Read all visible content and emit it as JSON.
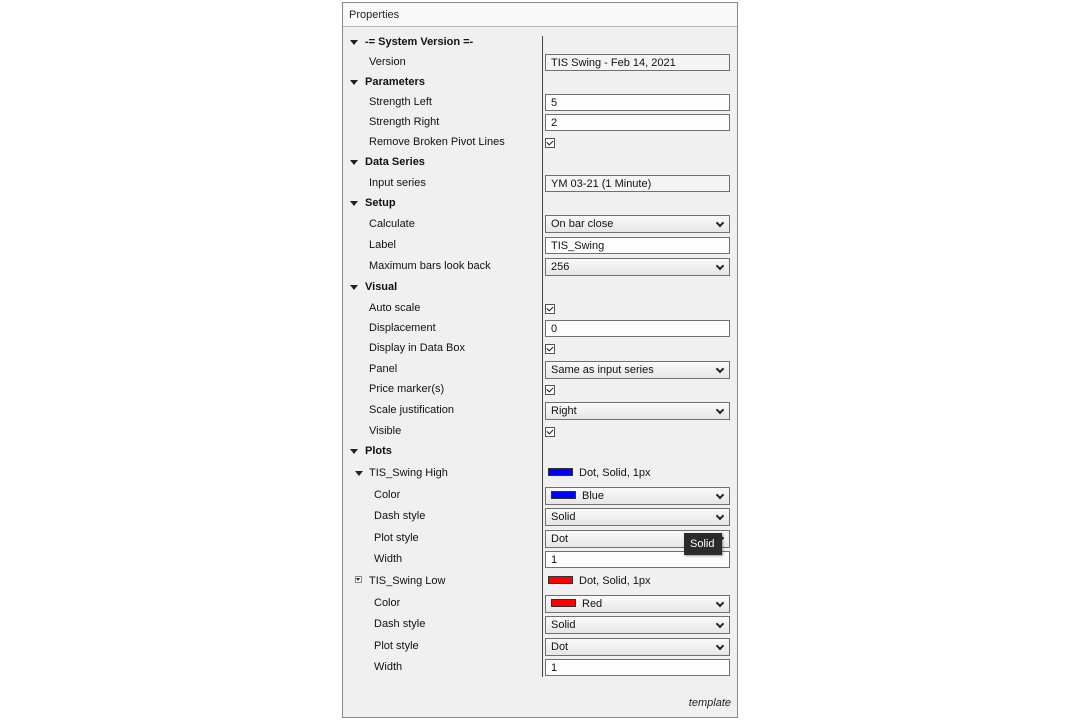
{
  "panel": {
    "title": "Properties",
    "footer": "template"
  },
  "tooltip": "Solid",
  "colors": {
    "blue": "#0000ff",
    "red": "#ff0000"
  },
  "groups": {
    "system_version": {
      "title": "-= System Version =-",
      "version": {
        "label": "Version",
        "value": "TIS Swing - Feb 14, 2021"
      }
    },
    "parameters": {
      "title": "Parameters",
      "strength_left": {
        "label": "Strength Left",
        "value": "5"
      },
      "strength_right": {
        "label": "Strength Right",
        "value": "2"
      },
      "remove_broken": {
        "label": "Remove Broken Pivot Lines",
        "checked": true
      }
    },
    "data_series": {
      "title": "Data Series",
      "input_series": {
        "label": "Input series",
        "value": "YM 03-21 (1 Minute)"
      }
    },
    "setup": {
      "title": "Setup",
      "calculate": {
        "label": "Calculate",
        "value": "On bar close"
      },
      "label": {
        "label": "Label",
        "value": "TIS_Swing"
      },
      "max_bars": {
        "label": "Maximum bars look back",
        "value": "256"
      }
    },
    "visual": {
      "title": "Visual",
      "auto_scale": {
        "label": "Auto scale",
        "checked": true
      },
      "displacement": {
        "label": "Displacement",
        "value": "0"
      },
      "display_data_box": {
        "label": "Display in Data Box",
        "checked": true
      },
      "panel": {
        "label": "Panel",
        "value": "Same as input series"
      },
      "price_markers": {
        "label": "Price marker(s)",
        "checked": true
      },
      "scale_justification": {
        "label": "Scale justification",
        "value": "Right"
      },
      "visible": {
        "label": "Visible",
        "checked": true
      }
    },
    "plots": {
      "title": "Plots",
      "high": {
        "name": "TIS_Swing High",
        "summary": "Dot, Solid, 1px",
        "color": {
          "label": "Color",
          "value": "Blue",
          "icon": "color-swatch-icon"
        },
        "dash_style": {
          "label": "Dash style",
          "value": "Solid"
        },
        "plot_style": {
          "label": "Plot style",
          "value": "Dot"
        },
        "width": {
          "label": "Width",
          "value": "1"
        }
      },
      "low": {
        "name": "TIS_Swing Low",
        "summary": "Dot, Solid, 1px",
        "color": {
          "label": "Color",
          "value": "Red",
          "icon": "color-swatch-icon"
        },
        "dash_style": {
          "label": "Dash style",
          "value": "Solid"
        },
        "plot_style": {
          "label": "Plot style",
          "value": "Dot"
        },
        "width": {
          "label": "Width",
          "value": "1"
        }
      }
    }
  }
}
